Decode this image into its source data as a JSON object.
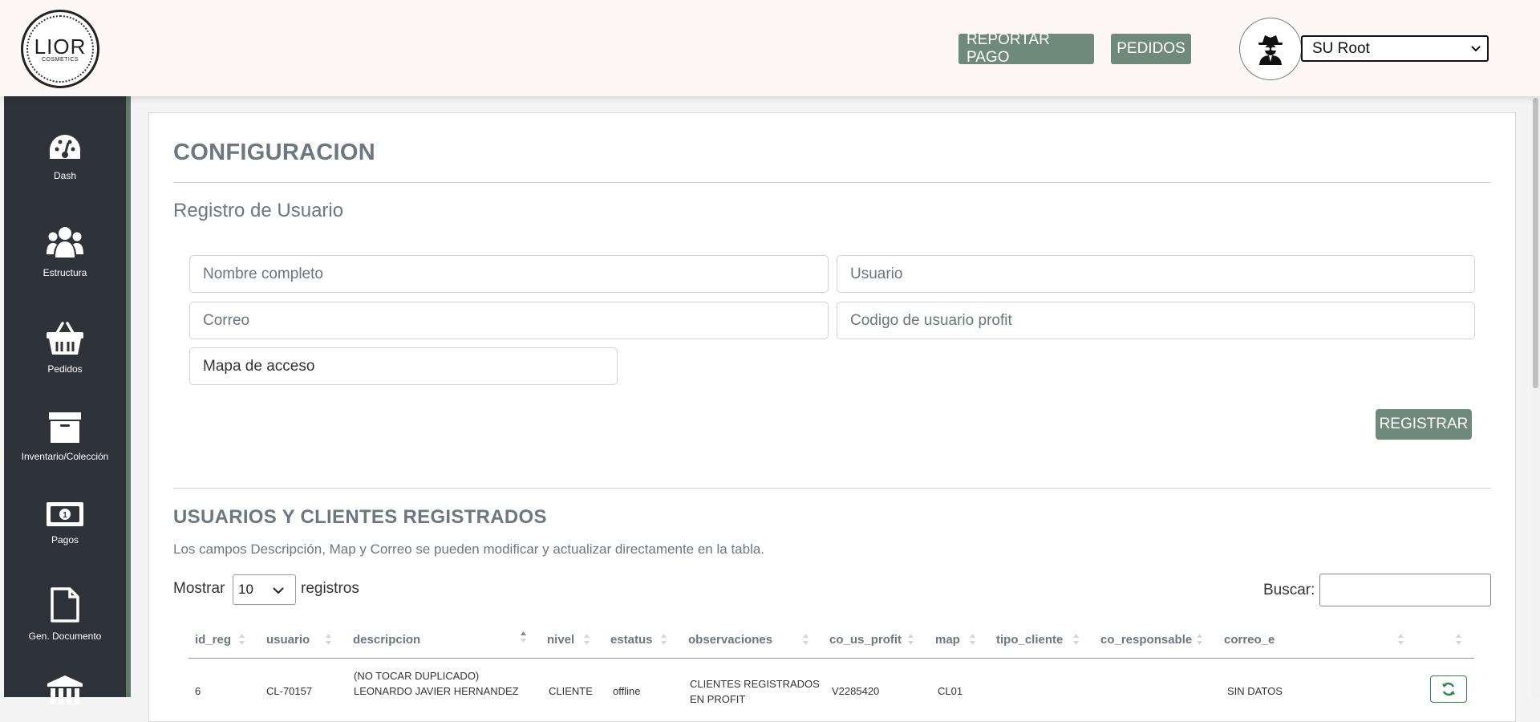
{
  "brand": {
    "logo_main": "LIOR",
    "logo_sub": "COSMETICS"
  },
  "topbar": {
    "reportar_pago": "REPORTAR PAGO",
    "pedidos": "PEDIDOS",
    "user_select": "SU Root"
  },
  "sidebar": {
    "items": [
      {
        "label": "Dash",
        "icon": "dashboard-gauge-icon"
      },
      {
        "label": "Estructura",
        "icon": "users-group-icon"
      },
      {
        "label": "Pedidos",
        "icon": "shopping-basket-icon"
      },
      {
        "label": "Inventario/Colección",
        "icon": "archive-box-icon"
      },
      {
        "label": "Pagos",
        "icon": "money-bill-icon"
      },
      {
        "label": "Gen. Documento",
        "icon": "document-icon"
      },
      {
        "label": "",
        "icon": "bank-building-icon"
      }
    ]
  },
  "page": {
    "title": "CONFIGURACION",
    "form_title": "Registro de Usuario",
    "fields": {
      "nombre_placeholder": "Nombre completo",
      "usuario_placeholder": "Usuario",
      "correo_placeholder": "Correo",
      "codigo_placeholder": "Codigo de usuario profit",
      "mapa_value": "Mapa de acceso"
    },
    "register_button": "REGISTRAR",
    "table_title": "USUARIOS Y CLIENTES REGISTRADOS",
    "table_note": "Los campos Descripción, Map y Correo se pueden modificar y actualizar directamente en la tabla.",
    "show_label": "Mostrar",
    "show_value": "10",
    "records_label": "registros",
    "search_label": "Buscar:"
  },
  "table": {
    "headers": [
      "id_reg",
      "usuario",
      "descripcion",
      "nivel",
      "estatus",
      "observaciones",
      "co_us_profit",
      "map",
      "tipo_cliente",
      "co_responsable",
      "correo_e"
    ],
    "rows": [
      {
        "id_reg": "6",
        "usuario": "CL-70157",
        "descripcion_1": "(NO TOCAR DUPLICADO)",
        "descripcion_2": "LEONARDO JAVIER HERNANDEZ",
        "nivel": "CLIENTE",
        "estatus": "offline",
        "observaciones_1": "CLIENTES REGISTRADOS",
        "observaciones_2": "EN PROFIT",
        "co_us_profit": "V2285420",
        "map": "CL01",
        "tipo_cliente": "",
        "co_responsable": "",
        "correo_e": "SIN DATOS"
      }
    ]
  },
  "colors": {
    "accent": "#6f8a7b",
    "sidebar": "#2e3339",
    "heading": "#6c7781"
  }
}
